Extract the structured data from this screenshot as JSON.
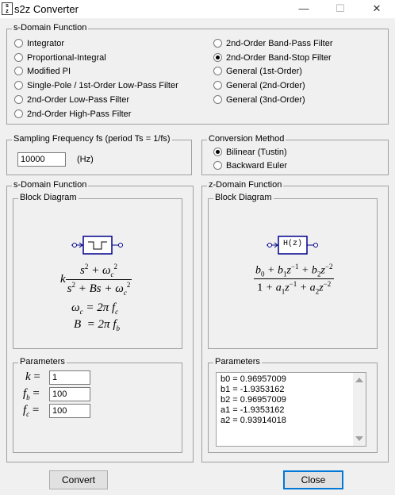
{
  "window": {
    "title": "s2z Converter",
    "icon_text_top": "s",
    "icon_text_bottom": "z"
  },
  "title_buttons": {
    "minimize": "—",
    "maximize": "☐",
    "close": "✕"
  },
  "s_domain_function_group": {
    "label": "s-Domain Function",
    "options": [
      {
        "label": "Integrator",
        "selected": false
      },
      {
        "label": "Proportional-Integral",
        "selected": false
      },
      {
        "label": "Modified PI",
        "selected": false
      },
      {
        "label": "Single-Pole / 1st-Order Low-Pass Filter",
        "selected": false
      },
      {
        "label": "2nd-Order Low-Pass Filter",
        "selected": false
      },
      {
        "label": "2nd-Order High-Pass Filter",
        "selected": false
      },
      {
        "label": "2nd-Order Band-Pass Filter",
        "selected": false
      },
      {
        "label": "2nd-Order Band-Stop Filter",
        "selected": true
      },
      {
        "label": "General (1st-Order)",
        "selected": false
      },
      {
        "label": "General (2nd-Order)",
        "selected": false
      },
      {
        "label": "General (3nd-Order)",
        "selected": false
      }
    ]
  },
  "sampling": {
    "label": "Sampling Frequency fs (period Ts = 1/fs)",
    "value": "10000",
    "unit": "(Hz)"
  },
  "conversion": {
    "label": "Conversion Method",
    "options": [
      {
        "label": "Bilinear (Tustin)",
        "selected": true
      },
      {
        "label": "Backward Euler",
        "selected": false
      }
    ]
  },
  "s_panel": {
    "label": "s-Domain Function",
    "block_label": "Block Diagram",
    "parameters_label": "Parameters",
    "params": [
      {
        "symbol": "k",
        "sub": "",
        "value": "1"
      },
      {
        "symbol": "f",
        "sub": "b",
        "value": "100"
      },
      {
        "symbol": "f",
        "sub": "c",
        "value": "100"
      }
    ]
  },
  "z_panel": {
    "label": "z-Domain Function",
    "block_label": "Block Diagram",
    "block_text": "H(z)",
    "parameters_label": "Parameters",
    "coefficients": [
      "b0 = 0.96957009",
      "b1 = -1.9353162",
      "b2 = 0.96957009",
      "a1 = -1.9353162",
      "a2 = 0.93914018"
    ]
  },
  "buttons": {
    "convert": "Convert",
    "close": "Close"
  }
}
